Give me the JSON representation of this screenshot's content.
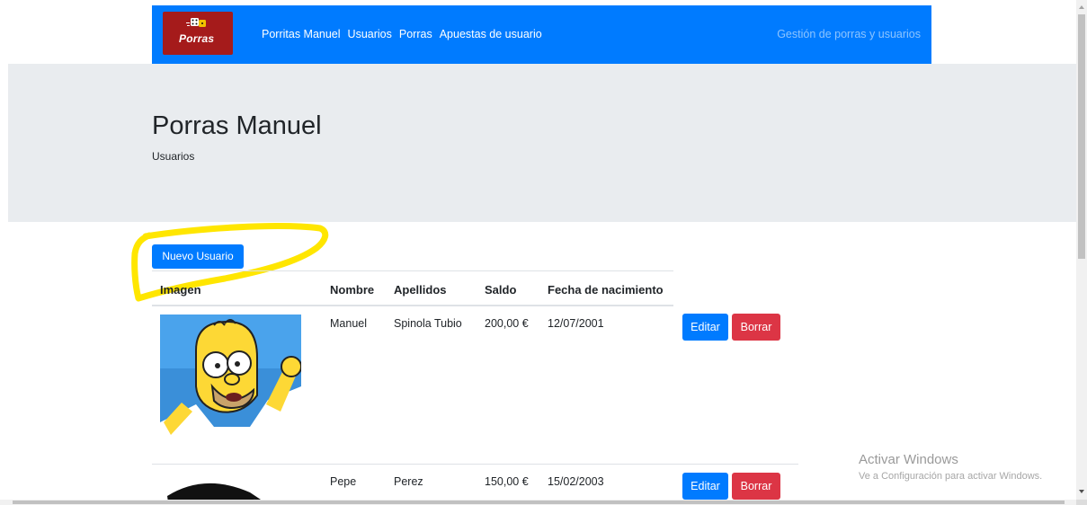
{
  "navbar": {
    "brand_text": "Porras",
    "links": [
      "Porritas Manuel",
      "Usuarios",
      "Porras",
      "Apuestas de usuario"
    ],
    "right_text": "Gestión de porras y usuarios",
    "background_color": "#007bff"
  },
  "jumbotron": {
    "title": "Porras Manuel",
    "subtitle": "Usuarios"
  },
  "actions": {
    "new_user_label": "Nuevo Usuario"
  },
  "table": {
    "columns": [
      "Imagen",
      "Nombre",
      "Apellidos",
      "Saldo",
      "Fecha de nacimiento"
    ],
    "rows": [
      {
        "image_icon": "homer-avatar",
        "nombre": "Manuel",
        "apellidos": "Spinola Tubio",
        "saldo": "200,00 €",
        "fecha": "12/07/2001",
        "edit_label": "Editar",
        "delete_label": "Borrar"
      },
      {
        "image_icon": "goku-avatar",
        "nombre": "Pepe",
        "apellidos": "Perez",
        "saldo": "150,00 €",
        "fecha": "15/02/2003",
        "edit_label": "Editar",
        "delete_label": "Borrar"
      }
    ]
  },
  "watermark": {
    "title": "Activar Windows",
    "subtitle": "Ve a Configuración para activar Windows."
  },
  "colors": {
    "primary": "#007bff",
    "danger": "#dc3545",
    "jumbotron": "#e9ecef",
    "highlight": "#ffe600",
    "brand_logo": "#a51b1b"
  }
}
